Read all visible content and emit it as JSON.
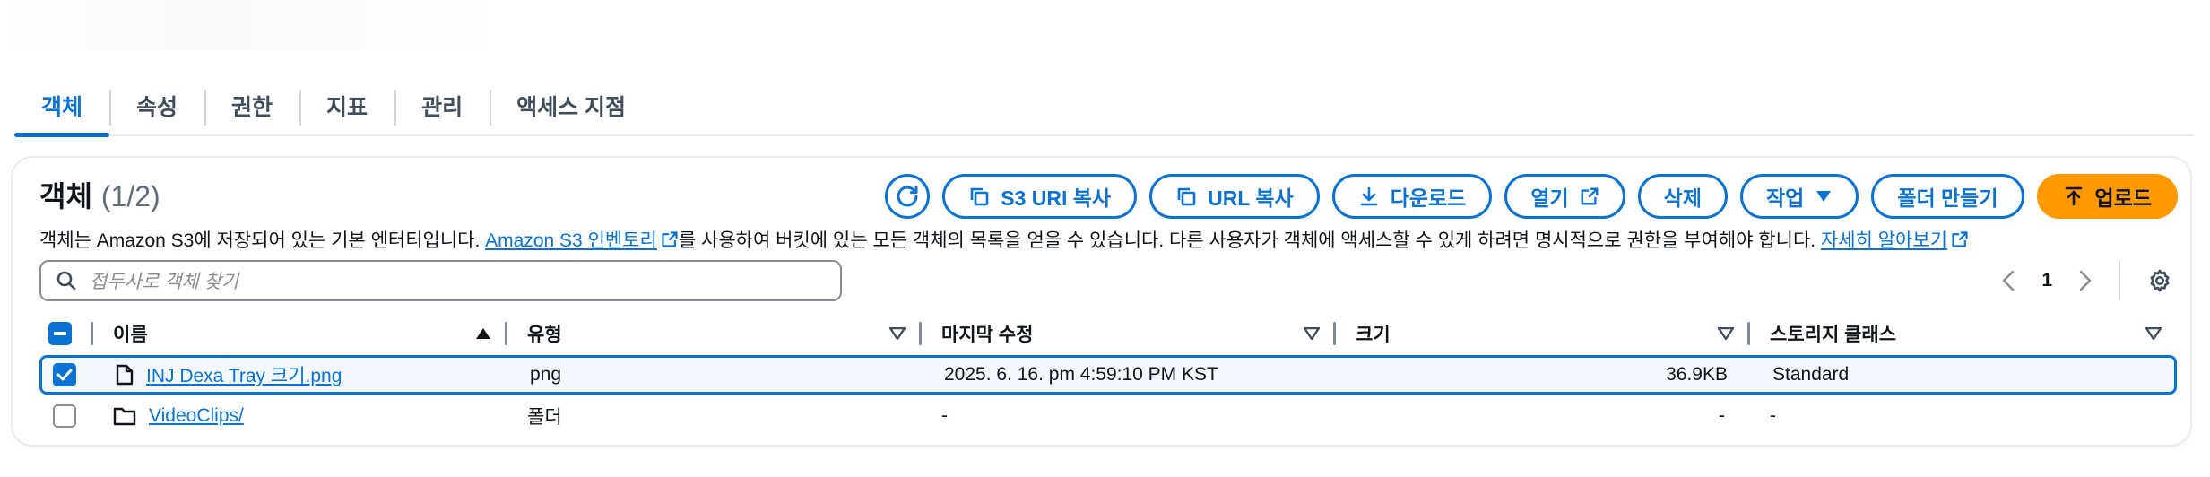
{
  "tabs": [
    {
      "label": "객체"
    },
    {
      "label": "속성"
    },
    {
      "label": "권한"
    },
    {
      "label": "지표"
    },
    {
      "label": "관리"
    },
    {
      "label": "액세스 지점"
    }
  ],
  "panel": {
    "title": "객체",
    "count": "(1/2)",
    "description": {
      "part1": "객체는 Amazon S3에 저장되어 있는 기본 엔터티입니다. ",
      "link1": "Amazon S3 인벤토리",
      "part2": "를 사용하여 버킷에 있는 모든 객체의 목록을 얻을 수 있습니다. 다른 사용자가 객체에 액세스할 수 있게 하려면 명시적으로 권한을 부여해야 합니다. ",
      "link2": "자세히 알아보기"
    }
  },
  "actions": {
    "copy_s3_uri": "S3 URI 복사",
    "copy_url": "URL 복사",
    "download": "다운로드",
    "open": "열기",
    "delete": "삭제",
    "actions": "작업",
    "create_folder": "폴더 만들기",
    "upload": "업로드"
  },
  "search": {
    "placeholder": "접두사로 객체 찾기"
  },
  "pagination": {
    "current_page": "1"
  },
  "table": {
    "columns": {
      "name": "이름",
      "type": "유형",
      "last_modified": "마지막 수정",
      "size": "크기",
      "storage_class": "스토리지 클래스"
    },
    "rows": [
      {
        "selected": true,
        "icon": "file-icon",
        "name": "INJ Dexa Tray 크기.png",
        "type": "png",
        "last_modified": "2025. 6. 16. pm 4:59:10 PM KST",
        "size": "36.9KB",
        "storage_class": "Standard"
      },
      {
        "selected": false,
        "icon": "folder-icon",
        "name": "VideoClips/",
        "type": "폴더",
        "last_modified": "-",
        "size": "-",
        "storage_class": "-"
      }
    ]
  },
  "colors": {
    "accent": "#0972d3",
    "primary_button": "#ff9900",
    "selected_row_bg": "#f2f8fd"
  }
}
